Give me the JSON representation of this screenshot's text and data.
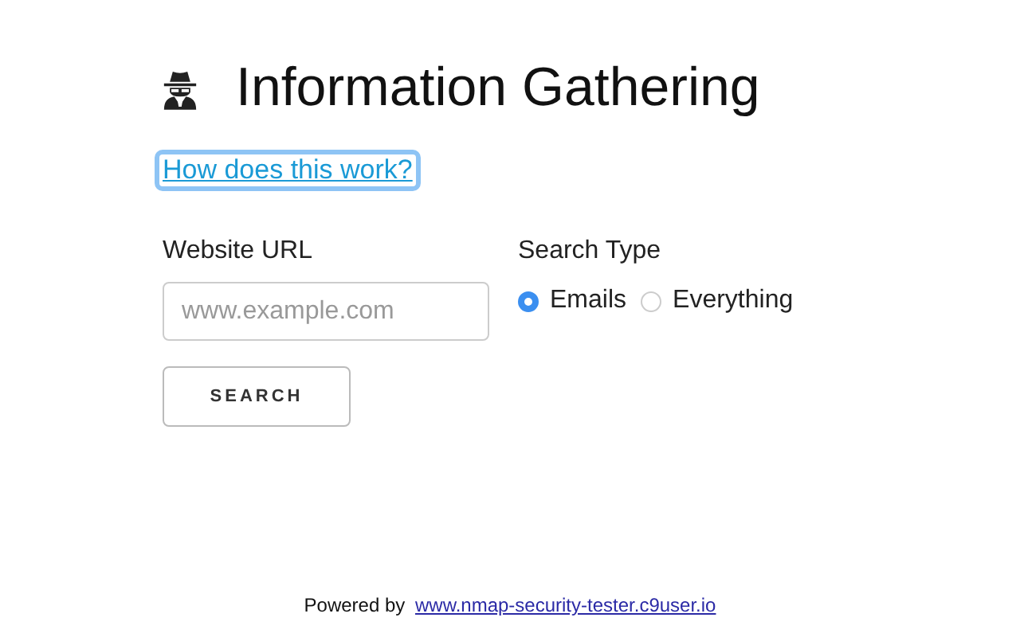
{
  "title": "Information Gathering",
  "help_link": {
    "label": "How does this work?",
    "focused": true
  },
  "url_field": {
    "label": "Website URL",
    "placeholder": "www.example.com"
  },
  "search_type": {
    "label": "Search Type",
    "options": [
      {
        "label": "Emails",
        "selected": true
      },
      {
        "label": "Everything",
        "selected": false
      }
    ]
  },
  "search_button": "SEARCH",
  "footer": {
    "text": "Powered by",
    "link": "www.nmap-security-tester.c9user.io"
  }
}
